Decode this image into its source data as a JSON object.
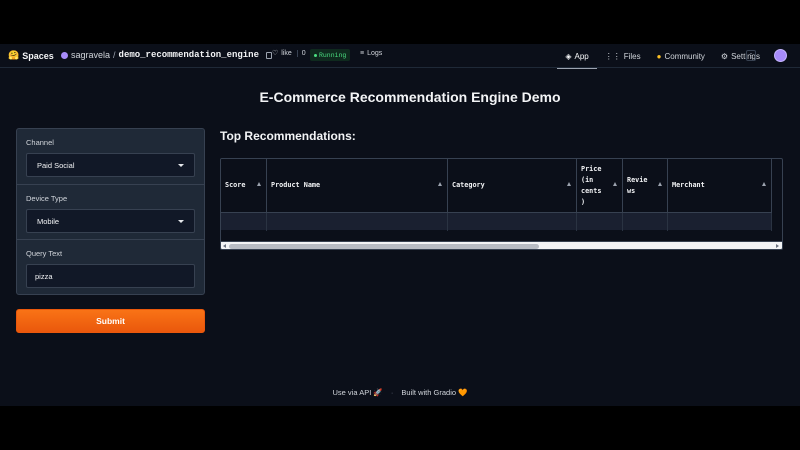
{
  "topbar": {
    "spaces_label": "Spaces",
    "owner": "sagravela",
    "slash": "/",
    "repo_name": "demo_recommendation_engine",
    "like_label": "like",
    "like_count": "0",
    "status": "Running",
    "logs_label": "Logs",
    "tabs": [
      {
        "label": "App",
        "icon": "app-icon"
      },
      {
        "label": "Files",
        "icon": "files-icon"
      },
      {
        "label": "Community",
        "icon": "community-icon"
      },
      {
        "label": "Settings",
        "icon": "gear-icon"
      }
    ],
    "menu_label": "⋮"
  },
  "app": {
    "title": "E-Commerce Recommendation Engine Demo",
    "form": {
      "channel_label": "Channel",
      "channel_value": "Paid Social",
      "device_label": "Device Type",
      "device_value": "Mobile",
      "query_label": "Query Text",
      "query_value": "pizza",
      "submit_label": "Submit"
    },
    "results": {
      "title": "Top Recommendations:",
      "columns": [
        "Score",
        "Product Name",
        "Category",
        "Price\n(in\ncents\n)",
        "Revie\nws",
        "Merchant"
      ]
    },
    "footer": {
      "api_label": "Use via API",
      "separator": "·",
      "built_label": "Built with Gradio"
    }
  },
  "colors": {
    "background": "#0b0f19",
    "panel": "#1f2937",
    "accent": "#f97316",
    "status_green": "#4ade80"
  }
}
